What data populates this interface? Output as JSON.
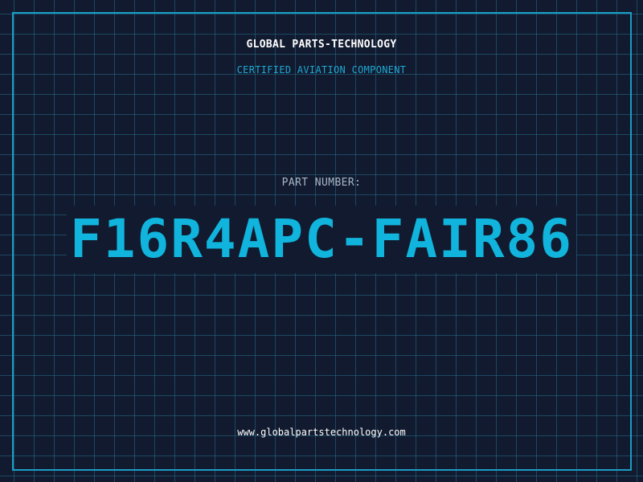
{
  "header": {
    "company": "GLOBAL PARTS-TECHNOLOGY",
    "tagline": "CERTIFIED AVIATION COMPONENT"
  },
  "part": {
    "label": "PART NUMBER:",
    "number": "F16R4APC-FAIR86"
  },
  "footer": {
    "website": "www.globalpartstechnology.com"
  },
  "colors": {
    "background": "#111a2e",
    "grid": "#266e8c",
    "accent": "#10b4dc",
    "frame": "#1a9dc4",
    "label": "#a9b6c8",
    "text": "#ffffff"
  }
}
